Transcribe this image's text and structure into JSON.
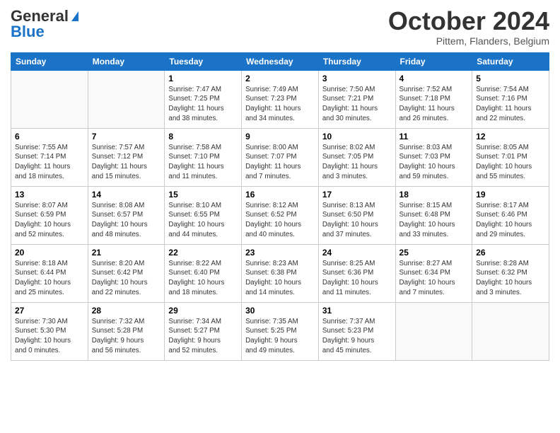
{
  "header": {
    "logo_general": "General",
    "logo_blue": "Blue",
    "month_title": "October 2024",
    "location": "Pittem, Flanders, Belgium"
  },
  "weekdays": [
    "Sunday",
    "Monday",
    "Tuesday",
    "Wednesday",
    "Thursday",
    "Friday",
    "Saturday"
  ],
  "weeks": [
    [
      {
        "num": "",
        "info": ""
      },
      {
        "num": "",
        "info": ""
      },
      {
        "num": "1",
        "info": "Sunrise: 7:47 AM\nSunset: 7:25 PM\nDaylight: 11 hours\nand 38 minutes."
      },
      {
        "num": "2",
        "info": "Sunrise: 7:49 AM\nSunset: 7:23 PM\nDaylight: 11 hours\nand 34 minutes."
      },
      {
        "num": "3",
        "info": "Sunrise: 7:50 AM\nSunset: 7:21 PM\nDaylight: 11 hours\nand 30 minutes."
      },
      {
        "num": "4",
        "info": "Sunrise: 7:52 AM\nSunset: 7:18 PM\nDaylight: 11 hours\nand 26 minutes."
      },
      {
        "num": "5",
        "info": "Sunrise: 7:54 AM\nSunset: 7:16 PM\nDaylight: 11 hours\nand 22 minutes."
      }
    ],
    [
      {
        "num": "6",
        "info": "Sunrise: 7:55 AM\nSunset: 7:14 PM\nDaylight: 11 hours\nand 18 minutes."
      },
      {
        "num": "7",
        "info": "Sunrise: 7:57 AM\nSunset: 7:12 PM\nDaylight: 11 hours\nand 15 minutes."
      },
      {
        "num": "8",
        "info": "Sunrise: 7:58 AM\nSunset: 7:10 PM\nDaylight: 11 hours\nand 11 minutes."
      },
      {
        "num": "9",
        "info": "Sunrise: 8:00 AM\nSunset: 7:07 PM\nDaylight: 11 hours\nand 7 minutes."
      },
      {
        "num": "10",
        "info": "Sunrise: 8:02 AM\nSunset: 7:05 PM\nDaylight: 11 hours\nand 3 minutes."
      },
      {
        "num": "11",
        "info": "Sunrise: 8:03 AM\nSunset: 7:03 PM\nDaylight: 10 hours\nand 59 minutes."
      },
      {
        "num": "12",
        "info": "Sunrise: 8:05 AM\nSunset: 7:01 PM\nDaylight: 10 hours\nand 55 minutes."
      }
    ],
    [
      {
        "num": "13",
        "info": "Sunrise: 8:07 AM\nSunset: 6:59 PM\nDaylight: 10 hours\nand 52 minutes."
      },
      {
        "num": "14",
        "info": "Sunrise: 8:08 AM\nSunset: 6:57 PM\nDaylight: 10 hours\nand 48 minutes."
      },
      {
        "num": "15",
        "info": "Sunrise: 8:10 AM\nSunset: 6:55 PM\nDaylight: 10 hours\nand 44 minutes."
      },
      {
        "num": "16",
        "info": "Sunrise: 8:12 AM\nSunset: 6:52 PM\nDaylight: 10 hours\nand 40 minutes."
      },
      {
        "num": "17",
        "info": "Sunrise: 8:13 AM\nSunset: 6:50 PM\nDaylight: 10 hours\nand 37 minutes."
      },
      {
        "num": "18",
        "info": "Sunrise: 8:15 AM\nSunset: 6:48 PM\nDaylight: 10 hours\nand 33 minutes."
      },
      {
        "num": "19",
        "info": "Sunrise: 8:17 AM\nSunset: 6:46 PM\nDaylight: 10 hours\nand 29 minutes."
      }
    ],
    [
      {
        "num": "20",
        "info": "Sunrise: 8:18 AM\nSunset: 6:44 PM\nDaylight: 10 hours\nand 25 minutes."
      },
      {
        "num": "21",
        "info": "Sunrise: 8:20 AM\nSunset: 6:42 PM\nDaylight: 10 hours\nand 22 minutes."
      },
      {
        "num": "22",
        "info": "Sunrise: 8:22 AM\nSunset: 6:40 PM\nDaylight: 10 hours\nand 18 minutes."
      },
      {
        "num": "23",
        "info": "Sunrise: 8:23 AM\nSunset: 6:38 PM\nDaylight: 10 hours\nand 14 minutes."
      },
      {
        "num": "24",
        "info": "Sunrise: 8:25 AM\nSunset: 6:36 PM\nDaylight: 10 hours\nand 11 minutes."
      },
      {
        "num": "25",
        "info": "Sunrise: 8:27 AM\nSunset: 6:34 PM\nDaylight: 10 hours\nand 7 minutes."
      },
      {
        "num": "26",
        "info": "Sunrise: 8:28 AM\nSunset: 6:32 PM\nDaylight: 10 hours\nand 3 minutes."
      }
    ],
    [
      {
        "num": "27",
        "info": "Sunrise: 7:30 AM\nSunset: 5:30 PM\nDaylight: 10 hours\nand 0 minutes."
      },
      {
        "num": "28",
        "info": "Sunrise: 7:32 AM\nSunset: 5:28 PM\nDaylight: 9 hours\nand 56 minutes."
      },
      {
        "num": "29",
        "info": "Sunrise: 7:34 AM\nSunset: 5:27 PM\nDaylight: 9 hours\nand 52 minutes."
      },
      {
        "num": "30",
        "info": "Sunrise: 7:35 AM\nSunset: 5:25 PM\nDaylight: 9 hours\nand 49 minutes."
      },
      {
        "num": "31",
        "info": "Sunrise: 7:37 AM\nSunset: 5:23 PM\nDaylight: 9 hours\nand 45 minutes."
      },
      {
        "num": "",
        "info": ""
      },
      {
        "num": "",
        "info": ""
      }
    ]
  ]
}
